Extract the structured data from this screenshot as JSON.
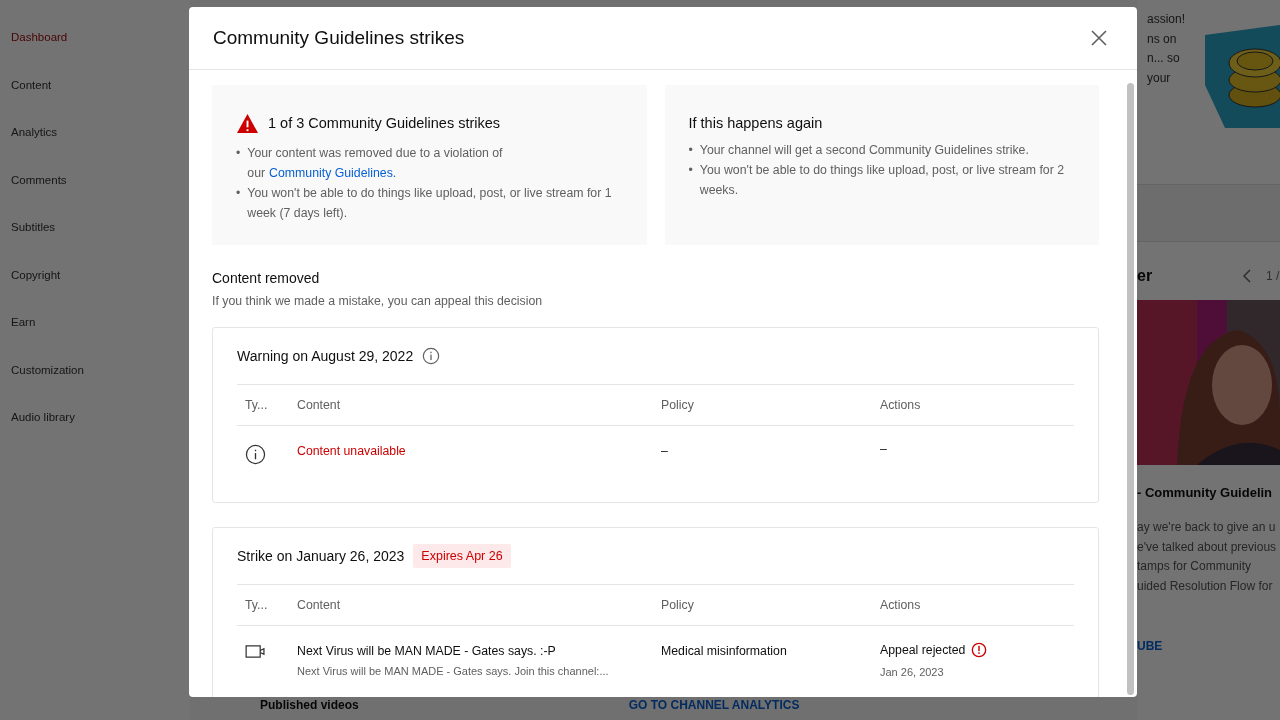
{
  "sidebar": {
    "items": [
      {
        "label": "Dashboard",
        "selected": true
      },
      {
        "label": "Content",
        "selected": false
      },
      {
        "label": "Analytics",
        "selected": false
      },
      {
        "label": "Comments",
        "selected": false
      },
      {
        "label": "Subtitles",
        "selected": false
      },
      {
        "label": "Copyright",
        "selected": false
      },
      {
        "label": "Earn",
        "selected": false
      },
      {
        "label": "Customization",
        "selected": false
      },
      {
        "label": "Audio library",
        "selected": false
      }
    ]
  },
  "side_panel": {
    "intro_lines": [
      "assion!",
      "ns on",
      "n... so",
      "your"
    ],
    "card_title": "er",
    "pager": "1 /",
    "video_title": "- Community Guidelin",
    "video_description": [
      "ay we're back to give an u",
      "e've talked about previous",
      "tamps for Community",
      "uided Resolution Flow for"
    ],
    "link": "UBE"
  },
  "footer": {
    "left": "Published videos",
    "right": "GO TO CHANNEL ANALYTICS"
  },
  "dialog": {
    "title": "Community Guidelines strikes",
    "summary": {
      "title": "1 of 3 Community Guidelines strikes",
      "bullets": [
        {
          "marker": "•",
          "text": "Your content was removed due to a violation of our",
          "link": "Community Guidelines."
        },
        {
          "marker": "•",
          "text": "You won't be able to do things like upload, post, or live stream for 1 week (7 days left)."
        }
      ]
    },
    "next": {
      "title": "If this happens again",
      "bullets": [
        {
          "marker": "•",
          "text": "Your channel will get a second Community Guidelines strike."
        },
        {
          "marker": "•",
          "text": "You won't be able to do things like upload, post, or live stream for 2 weeks."
        }
      ]
    },
    "section_title": "Content removed",
    "section_subtitle": "If you think we made a mistake, you can appeal this decision",
    "entries": [
      {
        "kind": "warning",
        "title": "Warning on August 29, 2022",
        "columns": [
          "Ty...",
          "Content",
          "Policy",
          "Actions"
        ],
        "rows": [
          {
            "kind": "info",
            "content": "Content unavailable",
            "unavailable": true,
            "policy": "–",
            "action": "–"
          }
        ]
      },
      {
        "kind": "strike",
        "title": "Strike on January 26, 2023",
        "badge": "Expires Apr 26",
        "columns": [
          "Ty...",
          "Content",
          "Policy",
          "Actions"
        ],
        "rows": [
          {
            "kind": "video",
            "content": "Next Virus will be MAN MADE - Gates says. :-P",
            "unavailable": false,
            "content_detail": "Next Virus will be MAN MADE - Gates says. Join this channel:...",
            "policy": "Medical misinformation",
            "action": "Appeal rejected",
            "action_alert": true,
            "action_date": "Jan 26, 2023"
          }
        ]
      }
    ]
  }
}
